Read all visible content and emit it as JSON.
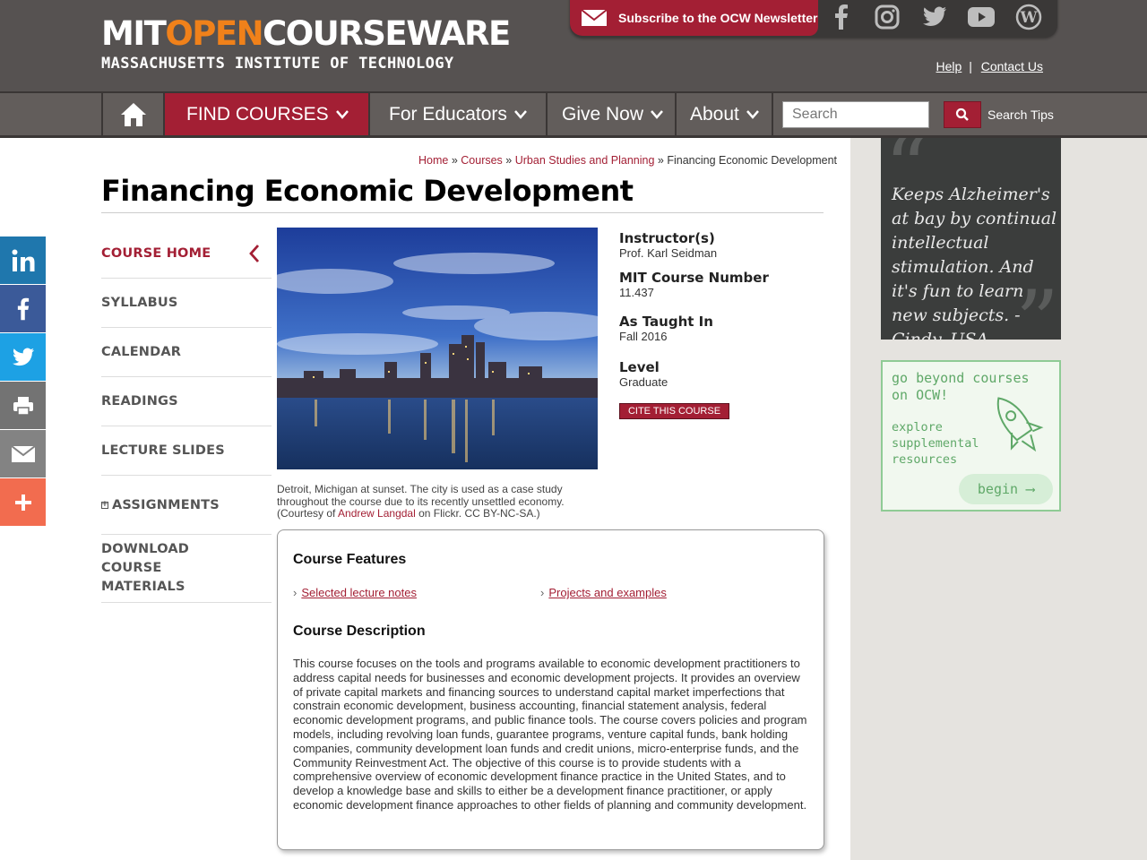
{
  "header": {
    "logo_mit": "MIT",
    "logo_open": "OPEN",
    "logo_courseware": "COURSEWARE",
    "logo_sub": "MASSACHUSETTS INSTITUTE OF TECHNOLOGY",
    "newsletter": "Subscribe to the OCW Newsletter",
    "help": "Help",
    "contact": "Contact Us",
    "separator": "|",
    "social_icons": [
      "facebook-icon",
      "instagram-icon",
      "twitter-icon",
      "youtube-icon",
      "wordpress-icon"
    ]
  },
  "nav": {
    "find_courses": "FIND COURSES",
    "for_educators": "For Educators",
    "give_now": "Give Now",
    "about": "About",
    "search_placeholder": "Search",
    "search_tips": "Search Tips"
  },
  "breadcrumb": {
    "home": "Home",
    "courses": "Courses",
    "dept": "Urban Studies and Planning",
    "current": "Financing Economic Development",
    "sep": "»"
  },
  "page_title": "Financing Economic Development",
  "side_menu": [
    {
      "label": "COURSE HOME"
    },
    {
      "label": "SYLLABUS"
    },
    {
      "label": "CALENDAR"
    },
    {
      "label": "READINGS"
    },
    {
      "label": "LECTURE SLIDES"
    },
    {
      "label": "ASSIGNMENTS"
    },
    {
      "label": "DOWNLOAD COURSE MATERIALS"
    }
  ],
  "image_caption": {
    "text": "Detroit, Michigan at sunset. The city is used as a case study throughout the course due to its recently unsettled economy. (Courtesy of ",
    "link": "Andrew Langdal",
    "tail": " on Flickr. CC BY-NC-SA.)"
  },
  "info": {
    "instructor_label": "Instructor(s)",
    "instructor": "Prof. Karl Seidman",
    "number_label": "MIT Course Number",
    "number": "11.437",
    "taught_label": "As Taught In",
    "taught": "Fall 2016",
    "level_label": "Level",
    "level": "Graduate",
    "cite": "CITE THIS COURSE"
  },
  "features": {
    "heading": "Course Features",
    "items": [
      "Selected lecture notes",
      "Projects and examples"
    ],
    "desc_heading": "Course Description",
    "description": "This course focuses on the tools and programs available to economic development practitioners to address capital needs for businesses and economic development projects. It provides an overview of private capital markets and financing sources to understand capital market imperfections that constrain economic development, business accounting, financial statement analysis, federal economic development programs, and public finance tools. The course covers policies and program models, including revolving loan funds, guarantee programs, venture capital funds, bank holding companies, community development loan funds and credit unions, micro-enterprise funds, and the Community Reinvestment Act. The objective of this course is to provide students with a comprehensive overview of economic development finance practice in the United States, and to develop a knowledge base and skills to either be a development finance practitioner, or apply economic development finance approaches to other fields of planning and community development."
  },
  "rail": {
    "quote": "Keeps Alzheimer's at bay by continual intellectual stimulation. And it's fun to learn new subjects. - Cindy, USA",
    "beyond_title": "go beyond courses on OCW!",
    "beyond_sub": "explore supplemental resources",
    "begin": "begin ⟶"
  },
  "share": [
    "linkedin-icon",
    "facebook-icon",
    "twitter-icon",
    "print-icon",
    "email-icon",
    "plus-icon"
  ],
  "colors": {
    "brand": "#a31f34",
    "header": "#565251",
    "accent_orange": "#f0811a",
    "green": "#5fa868"
  }
}
